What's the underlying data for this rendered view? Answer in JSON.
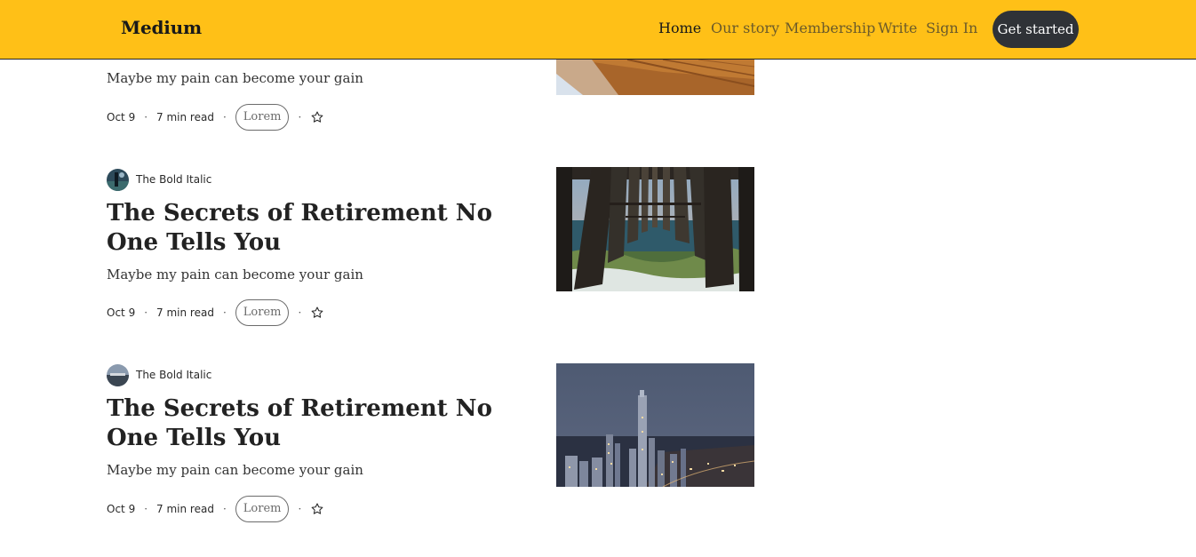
{
  "header": {
    "logo": "Medium",
    "nav": [
      {
        "label": "Home",
        "active": true
      },
      {
        "label": "Our story",
        "active": false
      },
      {
        "label": "Membership",
        "active": false
      },
      {
        "label": "Write",
        "active": false
      },
      {
        "label": "Sign In",
        "active": false
      }
    ],
    "cta_label": "Get started"
  },
  "colors": {
    "header_bg": "#ffc017",
    "cta_bg": "#2f3237"
  },
  "articles": [
    {
      "author": "",
      "title": "",
      "subtitle": "Maybe my pain can become your gain",
      "date": "Oct 9",
      "read_time": "7 min read",
      "tag": "Lorem",
      "image": "wooden-surface-photo"
    },
    {
      "author": "The Bold Italic",
      "title": "The Secrets of Retirement No One Tells You",
      "subtitle": "Maybe my pain can become your gain",
      "date": "Oct 9",
      "read_time": "7 min read",
      "tag": "Lorem",
      "image": "pier-ocean-photo"
    },
    {
      "author": "The Bold Italic",
      "title": "The Secrets of Retirement No One Tells You",
      "subtitle": "Maybe my pain can become your gain",
      "date": "Oct 9",
      "read_time": "7 min read",
      "tag": "Lorem",
      "image": "city-skyline-night-photo"
    }
  ],
  "icons": {
    "save": "star-outline-icon"
  }
}
